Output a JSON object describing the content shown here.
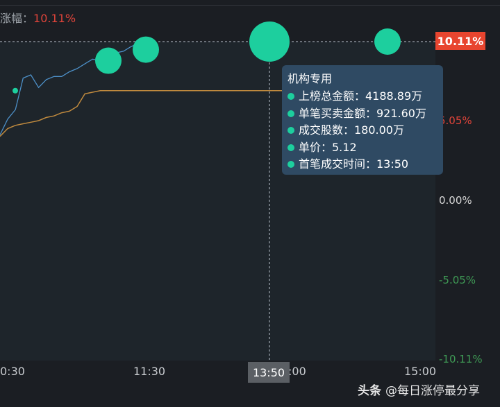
{
  "header": {
    "change_label": "涨幅：",
    "change_value": "10.11%"
  },
  "price_flag": "10.11%",
  "time_flag": "13:50",
  "y_ticks": [
    {
      "label": "10.11%",
      "color": "#e0443a"
    },
    {
      "label": "5.05%",
      "color": "#e0443a"
    },
    {
      "label": "0.00%",
      "color": "#d8d8d8"
    },
    {
      "label": "-5.05%",
      "color": "#3f9a55"
    },
    {
      "label": "-10.11%",
      "color": "#3f9a55"
    }
  ],
  "x_ticks": [
    "0:30",
    "11:30",
    ":00",
    "15:00"
  ],
  "tooltip": {
    "title": "机构专用",
    "rows": [
      "上榜总金额：4188.89万",
      "单笔买卖金额：921.60万",
      "成交股数：180.00万",
      "单价：5.12",
      "首笔成交时间：13:50"
    ]
  },
  "watermark": {
    "brand": "头条",
    "handle": "@每日涨停最分享"
  },
  "colors": {
    "up": "#e0443a",
    "down": "#3f9a55",
    "price_line": "#4d90c8",
    "avg_line": "#c08a3e",
    "bubble": "#1dcf9e",
    "tooltip_bg": "#2f4a63"
  },
  "chart_data": {
    "type": "line",
    "ylim": [
      -10.11,
      10.11
    ],
    "ytick_values": [
      10.11,
      5.05,
      0.0,
      -5.05,
      -10.11
    ],
    "xticks": [
      "0:30",
      "11:30",
      ":00",
      "15:00"
    ],
    "crosshair": {
      "time": "13:50",
      "value": 10.11
    },
    "series": [
      {
        "values": [
          4.2,
          5.2,
          5.8,
          7.8,
          8.0,
          7.2,
          7.7,
          7.9,
          7.9,
          8.2,
          8.4,
          8.7,
          9.0,
          8.9,
          9.2,
          9.4,
          9.5,
          9.8,
          10.0
        ]
      },
      {
        "values": [
          4.1,
          4.6,
          4.8,
          4.9,
          5.0,
          5.1,
          5.3,
          5.4,
          5.6,
          5.7,
          6.0,
          6.8,
          6.9,
          7.0,
          7.0,
          7.0,
          7.0,
          7.0,
          7.0
        ]
      }
    ],
    "bubbles": [
      {
        "value": 7.0,
        "size": "small"
      },
      {
        "value": 8.9,
        "size": "medium"
      },
      {
        "value": 9.6,
        "size": "medium"
      },
      {
        "time": "13:50",
        "value": 10.11,
        "size": "large"
      },
      {
        "value": 10.11,
        "size": "medium"
      }
    ]
  }
}
